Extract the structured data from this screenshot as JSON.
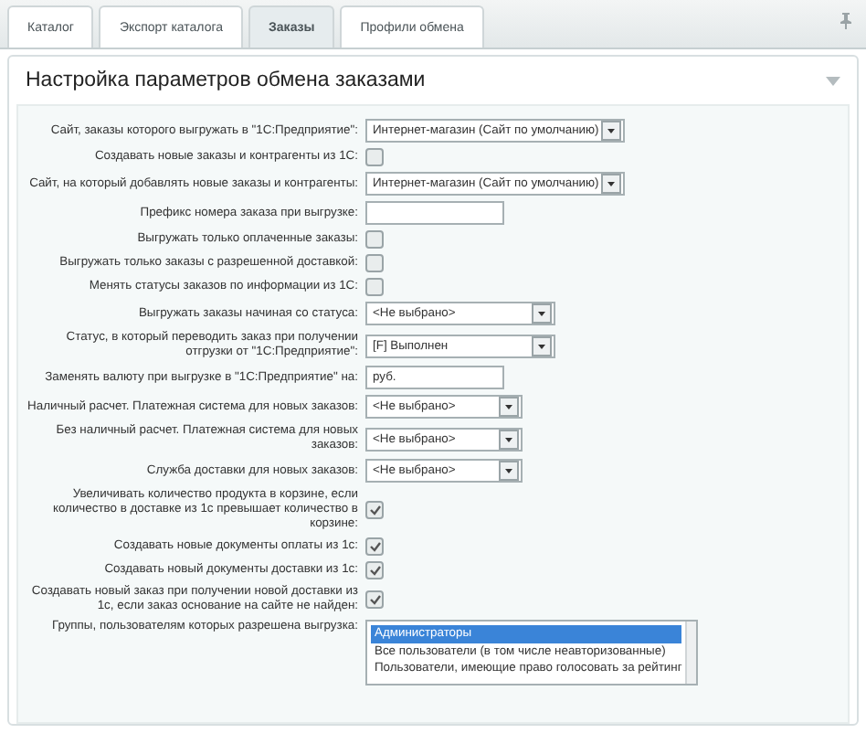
{
  "tabs": [
    {
      "label": "Каталог",
      "selected": false
    },
    {
      "label": "Экспорт каталога",
      "selected": false
    },
    {
      "label": "Заказы",
      "selected": true
    },
    {
      "label": "Профили обмена",
      "selected": false
    }
  ],
  "section": {
    "title": "Настройка параметров обмена заказами"
  },
  "fields": [
    {
      "kind": "select",
      "label": "Сайт, заказы которого выгружать в \"1С:Предприятие\":",
      "value": "Интернет-магазин (Сайт по умолчанию)"
    },
    {
      "kind": "checkbox",
      "label": "Создавать новые заказы и контрагенты из 1С:",
      "checked": false
    },
    {
      "kind": "select",
      "label": "Сайт, на который добавлять новые заказы и контрагенты:",
      "value": "Интернет-магазин (Сайт по умолчанию)"
    },
    {
      "kind": "text",
      "label": "Префикс номера заказа при выгрузке:"
    },
    {
      "kind": "checkbox",
      "label": "Выгружать только оплаченные заказы:",
      "checked": false
    },
    {
      "kind": "checkbox",
      "label": "Выгружать только заказы с разрешенной доставкой:",
      "checked": false
    },
    {
      "kind": "checkbox",
      "label": "Менять статусы заказов по информации из 1С:",
      "checked": false
    },
    {
      "kind": "select",
      "label": "Выгружать заказы начиная со статуса:",
      "value": "<Не выбрано>"
    },
    {
      "kind": "select",
      "label": "Статус, в который переводить заказ при получении отгрузки от \"1С:Предприятие\":",
      "value": "[F] Выполнен"
    },
    {
      "kind": "text",
      "label": "Заменять валюту при выгрузке в \"1С:Предприятие\" на:",
      "value": "руб."
    },
    {
      "kind": "select",
      "label": "Наличный расчет. Платежная система для новых заказов:",
      "value": "<Не выбрано>"
    },
    {
      "kind": "select",
      "label": "Без наличный расчет. Платежная система для новых заказов:",
      "value": "<Не выбрано>"
    },
    {
      "kind": "select",
      "label": "Служба доставки для новых заказов:",
      "value": "<Не выбрано>"
    },
    {
      "kind": "checkbox",
      "label": "Увеличивать количество продукта в корзине, если количество в доставке из 1с превышает количество в корзине:",
      "checked": true
    },
    {
      "kind": "checkbox",
      "label": "Создавать новые документы оплаты из 1с:",
      "checked": true
    },
    {
      "kind": "checkbox",
      "label": "Создавать новый документы доставки из 1с:",
      "checked": true
    },
    {
      "kind": "checkbox",
      "label": "Создавать новый заказ при получении новой доставки из 1с, если заказ основание на сайте не найден:",
      "checked": true
    },
    {
      "kind": "listbox",
      "label": "Группы, пользователям которых разрешена выгрузка:",
      "options": [
        {
          "label": "Администраторы",
          "selected": true
        },
        {
          "label": "Все пользователи (в том числе неавторизованные)",
          "selected": false
        },
        {
          "label": "Пользователи, имеющие право голосовать за рейтинг",
          "selected": false
        }
      ]
    }
  ]
}
